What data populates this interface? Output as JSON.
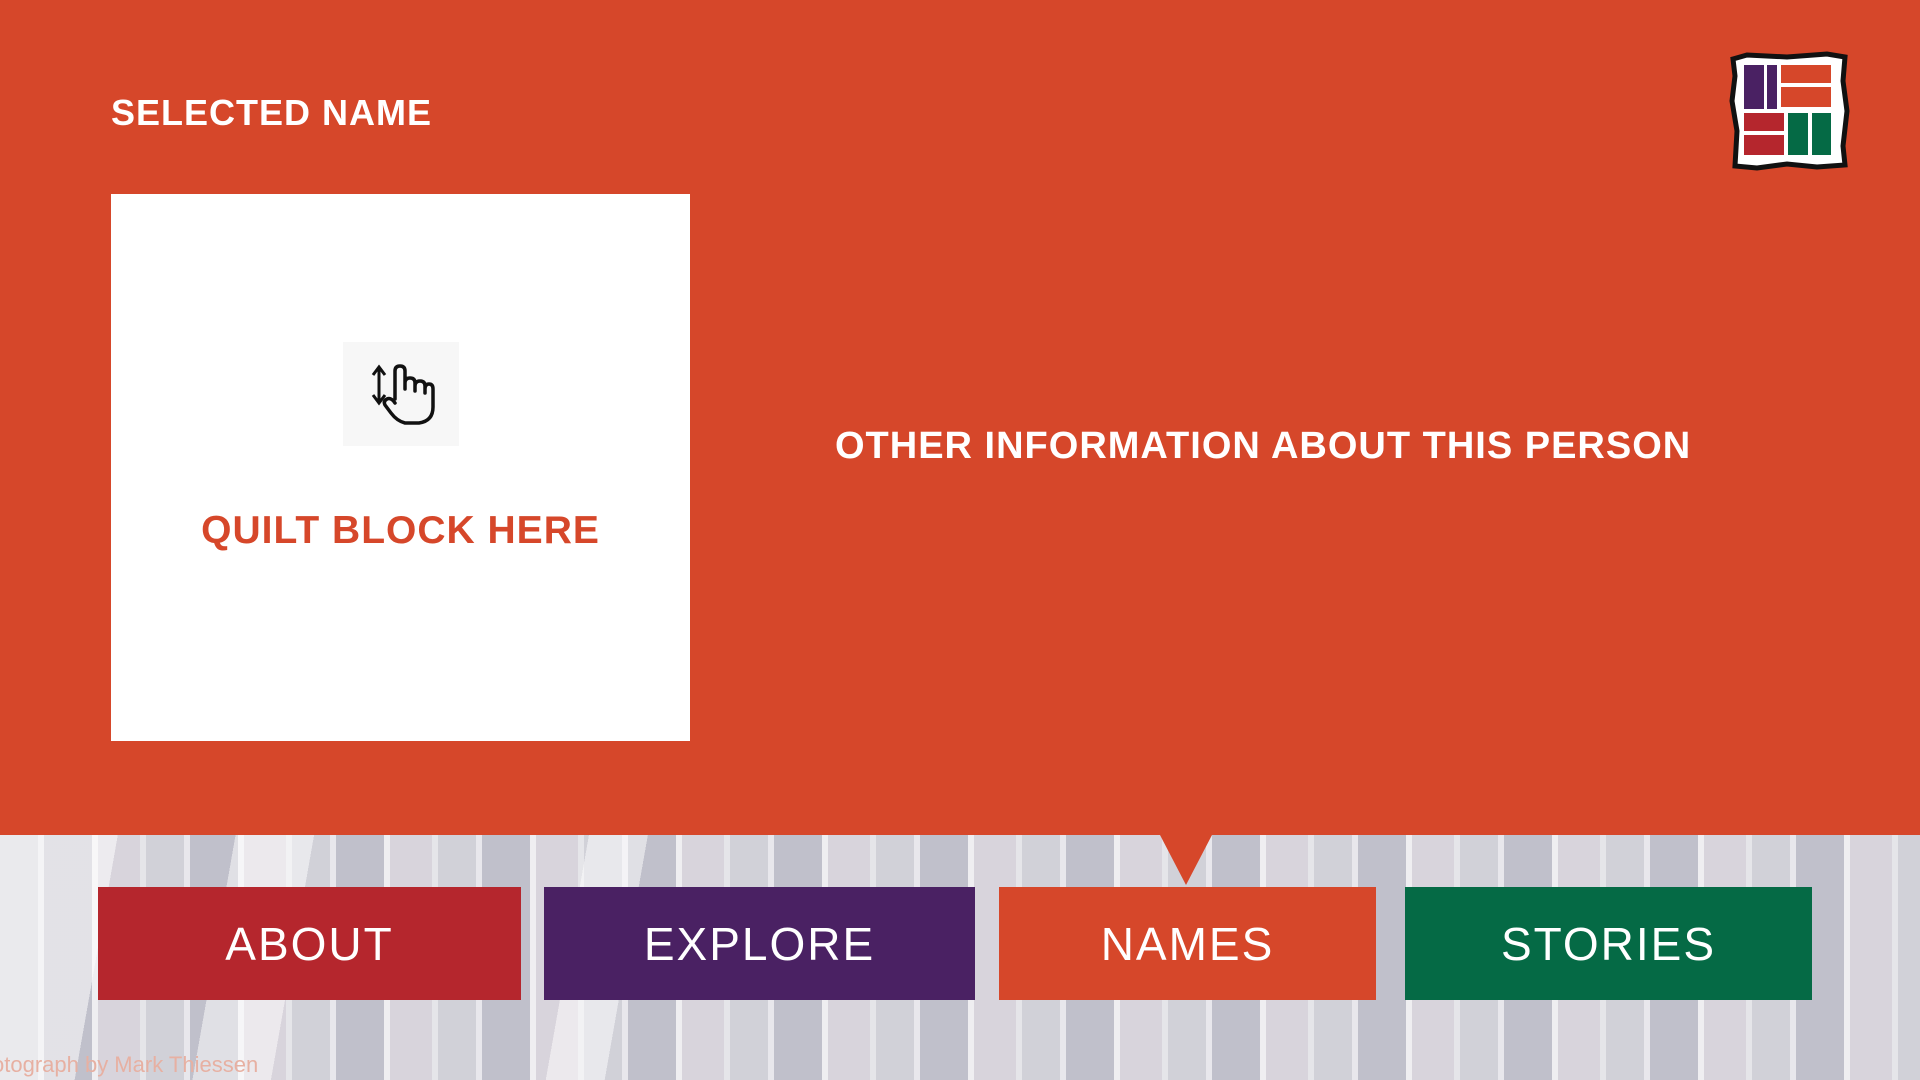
{
  "header": {
    "selected_name_label": "SELECTED NAME",
    "logo_icon": "quilt-logo-icon"
  },
  "quilt_block": {
    "placeholder_label": "QUILT BLOCK HERE",
    "gesture_icon": "touch-drag-icon"
  },
  "details": {
    "other_info_label": "OTHER INFORMATION ABOUT THIS PERSON"
  },
  "nav": {
    "active": "NAMES",
    "items": [
      {
        "label": "ABOUT",
        "color": "#b5262d"
      },
      {
        "label": "EXPLORE",
        "color": "#4a2163"
      },
      {
        "label": "NAMES",
        "color": "#d6472a"
      },
      {
        "label": "STORIES",
        "color": "#056a45"
      }
    ]
  },
  "footer": {
    "photo_credit": "otograph by Mark Thiessen"
  },
  "colors": {
    "background": "#d6472a",
    "text": "#ffffff"
  }
}
